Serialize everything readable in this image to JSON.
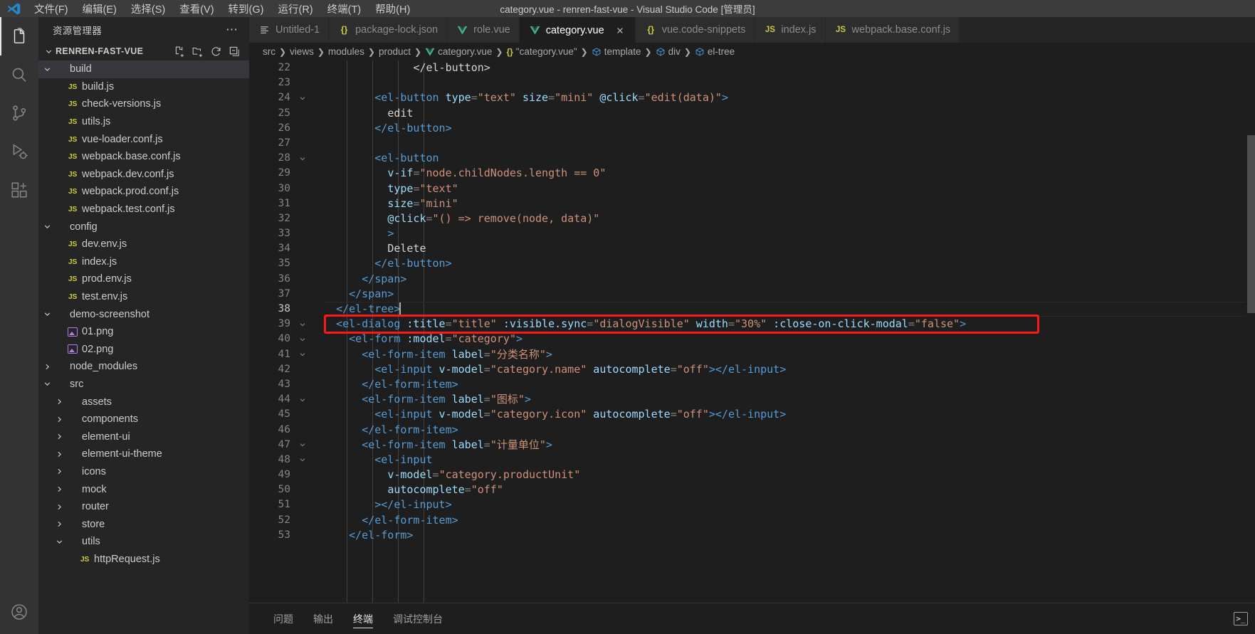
{
  "titlebar": {
    "window_title": "category.vue - renren-fast-vue - Visual Studio Code [管理员]",
    "menus": [
      {
        "label": "文件(F)",
        "name": "menu-file"
      },
      {
        "label": "编辑(E)",
        "name": "menu-edit"
      },
      {
        "label": "选择(S)",
        "name": "menu-selection"
      },
      {
        "label": "查看(V)",
        "name": "menu-view"
      },
      {
        "label": "转到(G)",
        "name": "menu-go"
      },
      {
        "label": "运行(R)",
        "name": "menu-run"
      },
      {
        "label": "终端(T)",
        "name": "menu-terminal"
      },
      {
        "label": "帮助(H)",
        "name": "menu-help"
      }
    ]
  },
  "activitybar": {
    "items": [
      {
        "icon": "files-explorer-icon",
        "active": true
      },
      {
        "icon": "search-icon",
        "active": false
      },
      {
        "icon": "source-control-icon",
        "active": false
      },
      {
        "icon": "run-debug-icon",
        "active": false
      },
      {
        "icon": "extensions-icon",
        "active": false
      }
    ],
    "bottom": [
      {
        "icon": "account-icon"
      },
      {
        "icon": "settings-gear-icon"
      }
    ]
  },
  "sidebar": {
    "title": "资源管理器",
    "more_actions": "⋯",
    "section_title": "RENREN-FAST-VUE",
    "actions": [
      "new-file-icon",
      "new-folder-icon",
      "refresh-icon",
      "collapse-all-icon"
    ],
    "tree": [
      {
        "label": "build",
        "type": "folder",
        "state": "expanded",
        "depth": 1,
        "selected": true
      },
      {
        "label": "build.js",
        "type": "js",
        "depth": 2
      },
      {
        "label": "check-versions.js",
        "type": "js",
        "depth": 2
      },
      {
        "label": "utils.js",
        "type": "js",
        "depth": 2
      },
      {
        "label": "vue-loader.conf.js",
        "type": "js",
        "depth": 2
      },
      {
        "label": "webpack.base.conf.js",
        "type": "js",
        "depth": 2
      },
      {
        "label": "webpack.dev.conf.js",
        "type": "js",
        "depth": 2
      },
      {
        "label": "webpack.prod.conf.js",
        "type": "js",
        "depth": 2
      },
      {
        "label": "webpack.test.conf.js",
        "type": "js",
        "depth": 2
      },
      {
        "label": "config",
        "type": "folder",
        "state": "expanded",
        "depth": 1
      },
      {
        "label": "dev.env.js",
        "type": "js",
        "depth": 2
      },
      {
        "label": "index.js",
        "type": "js",
        "depth": 2
      },
      {
        "label": "prod.env.js",
        "type": "js",
        "depth": 2
      },
      {
        "label": "test.env.js",
        "type": "js",
        "depth": 2
      },
      {
        "label": "demo-screenshot",
        "type": "folder",
        "state": "expanded",
        "depth": 1
      },
      {
        "label": "01.png",
        "type": "image",
        "depth": 2
      },
      {
        "label": "02.png",
        "type": "image",
        "depth": 2
      },
      {
        "label": "node_modules",
        "type": "folder",
        "state": "collapsed",
        "depth": 1
      },
      {
        "label": "src",
        "type": "folder",
        "state": "expanded",
        "depth": 1
      },
      {
        "label": "assets",
        "type": "folder",
        "state": "collapsed",
        "depth": 2
      },
      {
        "label": "components",
        "type": "folder",
        "state": "collapsed",
        "depth": 2
      },
      {
        "label": "element-ui",
        "type": "folder",
        "state": "collapsed",
        "depth": 2
      },
      {
        "label": "element-ui-theme",
        "type": "folder",
        "state": "collapsed",
        "depth": 2
      },
      {
        "label": "icons",
        "type": "folder",
        "state": "collapsed",
        "depth": 2
      },
      {
        "label": "mock",
        "type": "folder",
        "state": "collapsed",
        "depth": 2
      },
      {
        "label": "router",
        "type": "folder",
        "state": "collapsed",
        "depth": 2
      },
      {
        "label": "store",
        "type": "folder",
        "state": "collapsed",
        "depth": 2
      },
      {
        "label": "utils",
        "type": "folder",
        "state": "expanded",
        "depth": 2
      },
      {
        "label": "httpRequest.js",
        "type": "js",
        "depth": 3
      }
    ]
  },
  "tabs": [
    {
      "label": "Untitled-1",
      "icon": "file-text-icon",
      "active": false
    },
    {
      "label": "package-lock.json",
      "icon": "json-braces-icon",
      "active": false
    },
    {
      "label": "role.vue",
      "icon": "vue-icon",
      "active": false
    },
    {
      "label": "category.vue",
      "icon": "vue-icon",
      "active": true,
      "close": true
    },
    {
      "label": "vue.code-snippets",
      "icon": "json-braces-icon",
      "active": false
    },
    {
      "label": "index.js",
      "icon": "js-icon",
      "active": false
    },
    {
      "label": "webpack.base.conf.js",
      "icon": "js-icon",
      "active": false
    }
  ],
  "breadcrumbs": [
    {
      "label": "src",
      "icon": null
    },
    {
      "label": "views",
      "icon": null
    },
    {
      "label": "modules",
      "icon": null
    },
    {
      "label": "product",
      "icon": null
    },
    {
      "label": "category.vue",
      "icon": "vue-icon"
    },
    {
      "label": "\"category.vue\"",
      "icon": "json-braces-icon"
    },
    {
      "label": "template",
      "icon": "symbol-namespace-icon"
    },
    {
      "label": "div",
      "icon": "symbol-namespace-icon"
    },
    {
      "label": "el-tree",
      "icon": "symbol-namespace-icon"
    }
  ],
  "code": {
    "first_line": 22,
    "lines": [
      {
        "n": 22,
        "fold": false,
        "indent": 4,
        "tokens": [
          {
            "t": "      ",
            "c": "t-txt"
          },
          {
            "t": "</el-button>",
            "c": "t-tag-close"
          }
        ]
      },
      {
        "n": 23,
        "fold": false,
        "indent": 4,
        "tokens": []
      },
      {
        "n": 24,
        "fold": true,
        "indent": 4,
        "tokens": [
          {
            "t": "<el-button",
            "c": "tag"
          },
          {
            "t": " type",
            "c": "attr"
          },
          {
            "t": "=",
            "c": "pnc"
          },
          {
            "t": "\"text\"",
            "c": "str"
          },
          {
            "t": " size",
            "c": "attr"
          },
          {
            "t": "=",
            "c": "pnc"
          },
          {
            "t": "\"mini\"",
            "c": "str"
          },
          {
            "t": " @click",
            "c": "attr"
          },
          {
            "t": "=",
            "c": "pnc"
          },
          {
            "t": "\"edit(data)\"",
            "c": "str"
          },
          {
            "t": ">",
            "c": "tag"
          }
        ]
      },
      {
        "n": 25,
        "fold": false,
        "indent": 5,
        "tokens": [
          {
            "t": "edit",
            "c": "txt"
          }
        ]
      },
      {
        "n": 26,
        "fold": false,
        "indent": 4,
        "tokens": [
          {
            "t": "</el-button>",
            "c": "tag"
          }
        ]
      },
      {
        "n": 27,
        "fold": false,
        "indent": 4,
        "tokens": []
      },
      {
        "n": 28,
        "fold": true,
        "indent": 4,
        "tokens": [
          {
            "t": "<el-button",
            "c": "tag"
          }
        ]
      },
      {
        "n": 29,
        "fold": false,
        "indent": 5,
        "tokens": [
          {
            "t": "v-if",
            "c": "attr"
          },
          {
            "t": "=",
            "c": "pnc"
          },
          {
            "t": "\"node.childNodes.length == 0\"",
            "c": "str"
          }
        ]
      },
      {
        "n": 30,
        "fold": false,
        "indent": 5,
        "tokens": [
          {
            "t": "type",
            "c": "attr"
          },
          {
            "t": "=",
            "c": "pnc"
          },
          {
            "t": "\"text\"",
            "c": "str"
          }
        ]
      },
      {
        "n": 31,
        "fold": false,
        "indent": 5,
        "tokens": [
          {
            "t": "size",
            "c": "attr"
          },
          {
            "t": "=",
            "c": "pnc"
          },
          {
            "t": "\"mini\"",
            "c": "str"
          }
        ]
      },
      {
        "n": 32,
        "fold": false,
        "indent": 5,
        "tokens": [
          {
            "t": "@click",
            "c": "attr"
          },
          {
            "t": "=",
            "c": "pnc"
          },
          {
            "t": "\"() => remove(node, data)\"",
            "c": "str"
          }
        ]
      },
      {
        "n": 33,
        "fold": false,
        "indent": 5,
        "tokens": [
          {
            "t": ">",
            "c": "tag"
          }
        ]
      },
      {
        "n": 34,
        "fold": false,
        "indent": 5,
        "tokens": [
          {
            "t": "Delete",
            "c": "txt"
          }
        ]
      },
      {
        "n": 35,
        "fold": false,
        "indent": 4,
        "tokens": [
          {
            "t": "</el-button>",
            "c": "tag"
          }
        ]
      },
      {
        "n": 36,
        "fold": false,
        "indent": 3,
        "tokens": [
          {
            "t": "</span>",
            "c": "tag"
          }
        ]
      },
      {
        "n": 37,
        "fold": false,
        "indent": 2,
        "tokens": [
          {
            "t": "</span>",
            "c": "tag"
          }
        ]
      },
      {
        "n": 38,
        "fold": false,
        "indent": 1,
        "current": true,
        "tokens": [
          {
            "t": "</el-tree>",
            "c": "tag"
          }
        ]
      },
      {
        "n": 39,
        "fold": true,
        "indent": 1,
        "highlighted": true,
        "tokens": [
          {
            "t": "<el-dialog",
            "c": "tag"
          },
          {
            "t": " :title",
            "c": "attr"
          },
          {
            "t": "=",
            "c": "pnc"
          },
          {
            "t": "\"title\"",
            "c": "str"
          },
          {
            "t": " :visible.sync",
            "c": "attr"
          },
          {
            "t": "=",
            "c": "pnc"
          },
          {
            "t": "\"dialogVisible\"",
            "c": "str"
          },
          {
            "t": " width",
            "c": "attr"
          },
          {
            "t": "=",
            "c": "pnc"
          },
          {
            "t": "\"30%\"",
            "c": "str"
          },
          {
            "t": " :close-on-click-modal",
            "c": "attr"
          },
          {
            "t": "=",
            "c": "pnc"
          },
          {
            "t": "\"false\"",
            "c": "str"
          },
          {
            "t": ">",
            "c": "tag"
          }
        ]
      },
      {
        "n": 40,
        "fold": true,
        "indent": 2,
        "tokens": [
          {
            "t": "<el-form",
            "c": "tag"
          },
          {
            "t": " :model",
            "c": "attr"
          },
          {
            "t": "=",
            "c": "pnc"
          },
          {
            "t": "\"category\"",
            "c": "str"
          },
          {
            "t": ">",
            "c": "tag"
          }
        ]
      },
      {
        "n": 41,
        "fold": true,
        "indent": 3,
        "tokens": [
          {
            "t": "<el-form-item",
            "c": "tag"
          },
          {
            "t": " label",
            "c": "attr"
          },
          {
            "t": "=",
            "c": "pnc"
          },
          {
            "t": "\"分类名称\"",
            "c": "str"
          },
          {
            "t": ">",
            "c": "tag"
          }
        ]
      },
      {
        "n": 42,
        "fold": false,
        "indent": 4,
        "tokens": [
          {
            "t": "<el-input",
            "c": "tag"
          },
          {
            "t": " v-model",
            "c": "attr"
          },
          {
            "t": "=",
            "c": "pnc"
          },
          {
            "t": "\"category.name\"",
            "c": "str"
          },
          {
            "t": " autocomplete",
            "c": "attr"
          },
          {
            "t": "=",
            "c": "pnc"
          },
          {
            "t": "\"off\"",
            "c": "str"
          },
          {
            "t": "></el-input>",
            "c": "tag"
          }
        ]
      },
      {
        "n": 43,
        "fold": false,
        "indent": 3,
        "tokens": [
          {
            "t": "</el-form-item>",
            "c": "tag"
          }
        ]
      },
      {
        "n": 44,
        "fold": true,
        "indent": 3,
        "tokens": [
          {
            "t": "<el-form-item",
            "c": "tag"
          },
          {
            "t": " label",
            "c": "attr"
          },
          {
            "t": "=",
            "c": "pnc"
          },
          {
            "t": "\"图标\"",
            "c": "str"
          },
          {
            "t": ">",
            "c": "tag"
          }
        ]
      },
      {
        "n": 45,
        "fold": false,
        "indent": 4,
        "tokens": [
          {
            "t": "<el-input",
            "c": "tag"
          },
          {
            "t": " v-model",
            "c": "attr"
          },
          {
            "t": "=",
            "c": "pnc"
          },
          {
            "t": "\"category.icon\"",
            "c": "str"
          },
          {
            "t": " autocomplete",
            "c": "attr"
          },
          {
            "t": "=",
            "c": "pnc"
          },
          {
            "t": "\"off\"",
            "c": "str"
          },
          {
            "t": "></el-input>",
            "c": "tag"
          }
        ]
      },
      {
        "n": 46,
        "fold": false,
        "indent": 3,
        "tokens": [
          {
            "t": "</el-form-item>",
            "c": "tag"
          }
        ]
      },
      {
        "n": 47,
        "fold": true,
        "indent": 3,
        "tokens": [
          {
            "t": "<el-form-item",
            "c": "tag"
          },
          {
            "t": " label",
            "c": "attr"
          },
          {
            "t": "=",
            "c": "pnc"
          },
          {
            "t": "\"计量单位\"",
            "c": "str"
          },
          {
            "t": ">",
            "c": "tag"
          }
        ]
      },
      {
        "n": 48,
        "fold": true,
        "indent": 4,
        "tokens": [
          {
            "t": "<el-input",
            "c": "tag"
          }
        ]
      },
      {
        "n": 49,
        "fold": false,
        "indent": 5,
        "tokens": [
          {
            "t": "v-model",
            "c": "attr"
          },
          {
            "t": "=",
            "c": "pnc"
          },
          {
            "t": "\"category.productUnit\"",
            "c": "str"
          }
        ]
      },
      {
        "n": 50,
        "fold": false,
        "indent": 5,
        "tokens": [
          {
            "t": "autocomplete",
            "c": "attr"
          },
          {
            "t": "=",
            "c": "pnc"
          },
          {
            "t": "\"off\"",
            "c": "str"
          }
        ]
      },
      {
        "n": 51,
        "fold": false,
        "indent": 4,
        "tokens": [
          {
            "t": "></el-input>",
            "c": "tag"
          }
        ]
      },
      {
        "n": 52,
        "fold": false,
        "indent": 3,
        "tokens": [
          {
            "t": "</el-form-item>",
            "c": "tag"
          }
        ]
      },
      {
        "n": 53,
        "fold": false,
        "indent": 2,
        "tokens": [
          {
            "t": "</el-form>",
            "c": "tag"
          }
        ]
      }
    ],
    "annotation": {
      "shape": "rectangle",
      "color": "#fb1a1a",
      "target_line": 39
    }
  },
  "panel": {
    "tabs": [
      {
        "label": "问题",
        "active": false
      },
      {
        "label": "输出",
        "active": false
      },
      {
        "label": "终端",
        "active": true
      },
      {
        "label": "调试控制台",
        "active": false
      }
    ],
    "right_icons": [
      "terminal-split-icon"
    ]
  },
  "colors": {
    "accent": "#007acc",
    "annotation_red": "#fb1a1a",
    "editor_bg": "#1e1e1e",
    "sidebar_bg": "#252526",
    "activitybar_bg": "#333333",
    "titlebar_bg": "#3c3c3c"
  }
}
